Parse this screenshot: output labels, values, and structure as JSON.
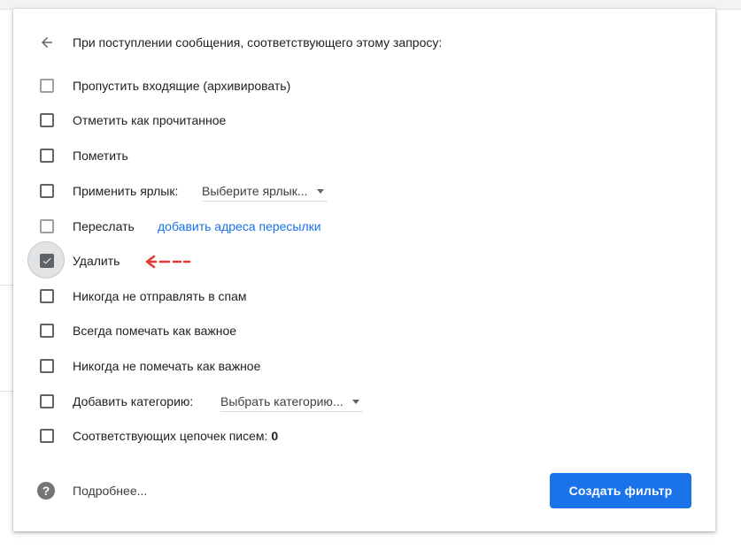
{
  "header": {
    "title": "При поступлении сообщения, соответствующего этому запросу:",
    "back_icon": "arrow-back-icon"
  },
  "actions": [
    {
      "label": "Пропустить входящие (архивировать)",
      "checked": false
    },
    {
      "label": "Отметить как прочитанное",
      "checked": false
    },
    {
      "label": "Пометить",
      "checked": false
    },
    {
      "label": "Применить ярлык:",
      "checked": false,
      "dropdown": "Выберите ярлык..."
    },
    {
      "label": "Переслать",
      "checked": false,
      "link": "добавить адреса пересылки"
    },
    {
      "label": "Удалить",
      "checked": true
    },
    {
      "label": "Никогда не отправлять в спам",
      "checked": false
    },
    {
      "label": "Всегда помечать как важное",
      "checked": false
    },
    {
      "label": "Никогда не помечать как важное",
      "checked": false
    },
    {
      "label": "Добавить категорию:",
      "checked": false,
      "dropdown": "Выбрать категорию..."
    },
    {
      "label": "Соответствующих цепочек писем:",
      "checked": false,
      "count": "0"
    }
  ],
  "footer": {
    "help_label": "Подробнее...",
    "create_button": "Создать фильтр"
  },
  "colors": {
    "accent": "#1a73e8",
    "annotation_arrow": "#e53935"
  }
}
